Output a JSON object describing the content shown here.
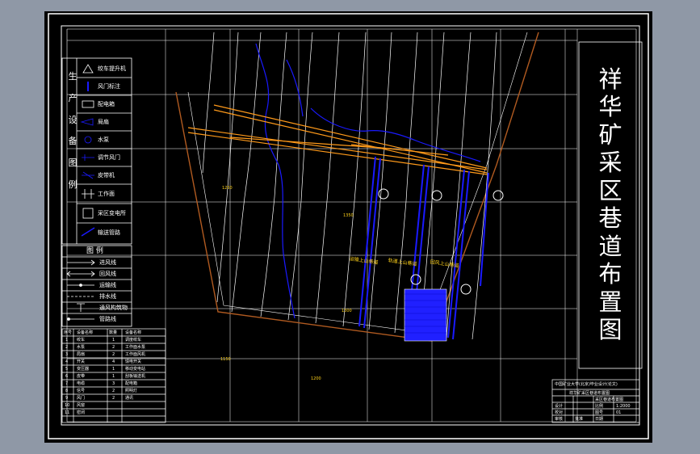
{
  "drawing": {
    "title_chars": [
      "祥",
      "华",
      "矿",
      "采",
      "区",
      "巷",
      "道",
      "布",
      "置",
      "图"
    ],
    "title_line": "祥华矿采区巷道布置图",
    "colors": {
      "background": "#000000",
      "frame": "#ffffff",
      "contour": "#ffffff",
      "seam": "#1a1aff",
      "tunnel": "#ff9a1a",
      "boundary": "#b05a20",
      "annotation": "#ffd21a"
    }
  },
  "equipment_legend": {
    "heading_chars": [
      "生",
      "产",
      "设",
      "备",
      "图",
      "例"
    ],
    "items": [
      {
        "icon": "hoist-icon",
        "label": "绞车提升机"
      },
      {
        "icon": "arrow-icon",
        "label": "风门标注"
      },
      {
        "icon": "rect-icon",
        "label": "配电箱"
      },
      {
        "icon": "fan-icon",
        "label": "局扇"
      },
      {
        "icon": "pump-icon",
        "label": "水泵"
      },
      {
        "icon": "valve-icon",
        "label": "调节风门"
      },
      {
        "icon": "conveyor-icon",
        "label": "皮带机"
      },
      {
        "icon": "bracket-icon",
        "label": "工作面"
      },
      {
        "icon": "box-icon",
        "label": "采区变电所"
      },
      {
        "icon": "pipe-icon",
        "label": "输送管路"
      }
    ]
  },
  "line_legend": {
    "heading": "图 例",
    "items": [
      {
        "icon": "arrow-line-icon",
        "label": "进风线"
      },
      {
        "icon": "double-arrow-line-icon",
        "label": "回风线"
      },
      {
        "icon": "dot-line-icon",
        "label": "运输线"
      },
      {
        "icon": "dash-line-icon",
        "label": "排水线"
      },
      {
        "icon": "tee-icon",
        "label": "通风构筑物"
      },
      {
        "icon": "plain-line-icon",
        "label": "管路线"
      }
    ]
  },
  "device_table": {
    "header": [
      "序号",
      "设备名称",
      "数量",
      "设备名称"
    ],
    "rows": [
      [
        "1",
        "绞车",
        "1",
        "调度绞车"
      ],
      [
        "2",
        "水泵",
        "2",
        "工作面水泵"
      ],
      [
        "3",
        "局扇",
        "2",
        "工作面风机"
      ],
      [
        "4",
        "开关",
        "4",
        "馈电开关"
      ],
      [
        "5",
        "变压器",
        "1",
        "移动变电站"
      ],
      [
        "6",
        "皮带",
        "1",
        "刮板输送机"
      ],
      [
        "7",
        "电缆",
        "3",
        "配电箱"
      ],
      [
        "8",
        "信号",
        "2",
        "照明灯"
      ],
      [
        "9",
        "风门",
        "2",
        "通讯"
      ],
      [
        "10",
        "风窗",
        "",
        ""
      ],
      [
        "11",
        "密闭",
        "",
        ""
      ]
    ]
  },
  "title_block": {
    "school": "中国矿业大学(北京)毕业设计(论文)",
    "subtitle": "祥华矿采区巷道布置图",
    "drawing_name": "采区巷道布置图",
    "rows": [
      [
        "设计",
        "",
        "比例",
        "1:2000"
      ],
      [
        "校对",
        "",
        "图号",
        "01"
      ],
      [
        "审核",
        "",
        "日期",
        ""
      ],
      [
        "批准",
        "",
        "",
        ""
      ]
    ]
  },
  "tunnel_labels": [
    "运输上山巷道",
    "轨道上山巷道",
    "回风上山巷道"
  ],
  "elevation_notes": [
    "1150",
    "1200",
    "1250",
    "1300",
    "1350"
  ]
}
